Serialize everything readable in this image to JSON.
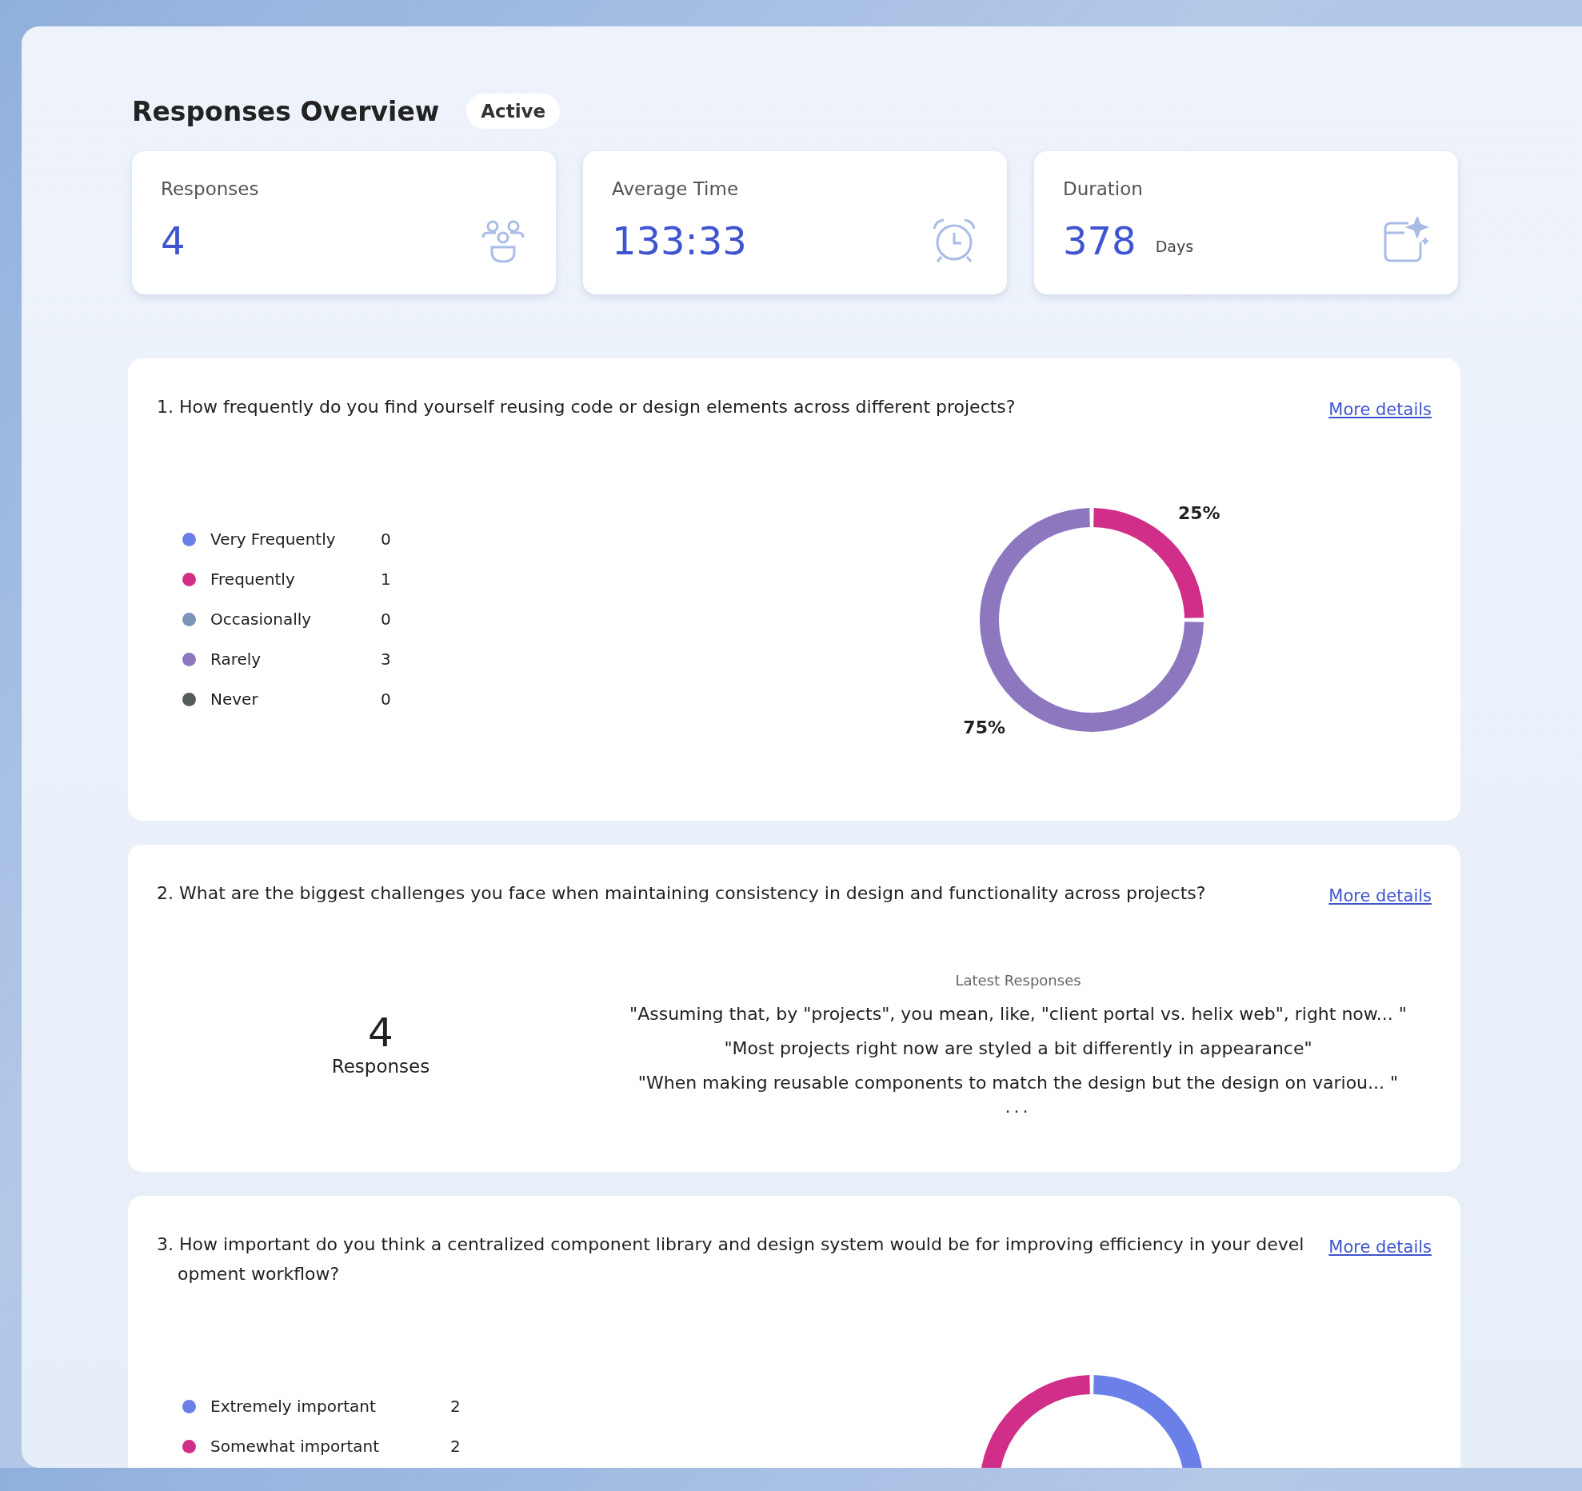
{
  "header": {
    "title": "Responses Overview",
    "status": "Active"
  },
  "stats": [
    {
      "label": "Responses",
      "value": "4"
    },
    {
      "label": "Average Time",
      "value": "133:33"
    },
    {
      "label": "Duration",
      "value": "378",
      "unit": "Days"
    }
  ],
  "questions": [
    {
      "kind": "choice",
      "title": "1. How frequently do you find yourself reusing code or design elements across different projects?",
      "link": "More details",
      "options": [
        {
          "count": "0",
          "color": "#6b7fe8"
        },
        {
          "count": "1",
          "color": "#d12e8a"
        },
        {
          "count": "0",
          "color": "#7b93b8"
        },
        {
          "count": "3",
          "color": "#8d78c0"
        },
        {
          "count": "0",
          "color": "#555b57"
        }
      ],
      "chart_data": {
        "type": "donut",
        "categories": [
          "Very Frequently",
          "Frequently",
          "Occasionally",
          "Rarely",
          "Never"
        ],
        "values": [
          0,
          25,
          0,
          75,
          0
        ],
        "value_labels": [
          null,
          "25%",
          null,
          "75%",
          null
        ]
      }
    },
    {
      "kind": "text",
      "title": "2. What are the biggest challenges you face when maintaining consistency in design and functionality across projects?",
      "link": "More details",
      "count": "4",
      "count_label": "Responses",
      "latest_title": "Latest Responses",
      "responses": [
        "\"Assuming that, by \"projects\", you mean, like, \"client portal vs. helix web\", right now... \"",
        "\"Most projects right now are styled a bit differently in appearance\"",
        "\"When making reusable components to match the design but the design on variou... \""
      ],
      "more": "..."
    },
    {
      "kind": "choice",
      "title": "3. How important do you think a centralized component library and design system would be for improving efficiency in your development workflow?",
      "link": "More details",
      "options": [
        {
          "count": "2",
          "color": "#6b7fe8"
        },
        {
          "count": "2",
          "color": "#d12e8a"
        }
      ],
      "chart_data": {
        "type": "donut",
        "categories": [
          "Extremely important",
          "Somewhat important"
        ],
        "values": [
          50,
          50
        ]
      }
    }
  ]
}
